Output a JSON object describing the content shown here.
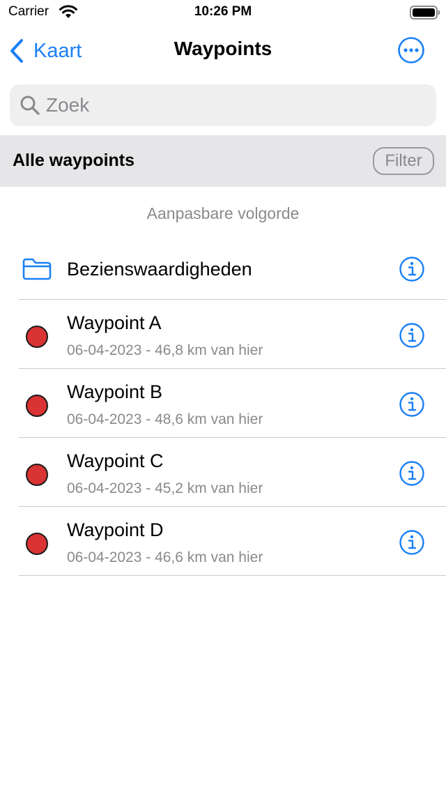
{
  "status_bar": {
    "carrier": "Carrier",
    "time": "10:26 PM"
  },
  "nav": {
    "back_label": "Kaart",
    "title": "Waypoints"
  },
  "search": {
    "placeholder": "Zoek"
  },
  "section": {
    "title": "Alle waypoints",
    "filter_label": "Filter"
  },
  "order_label": "Aanpasbare volgorde",
  "folder": {
    "label": "Bezienswaardigheden"
  },
  "waypoints": [
    {
      "name": "Waypoint A",
      "detail": "06-04-2023 - 46,8 km van hier"
    },
    {
      "name": "Waypoint B",
      "detail": "06-04-2023 - 48,6 km van hier"
    },
    {
      "name": "Waypoint C",
      "detail": "06-04-2023 - 45,2 km van hier"
    },
    {
      "name": "Waypoint D",
      "detail": "06-04-2023 - 46,6 km van hier"
    }
  ],
  "colors": {
    "accent": "#1a7ff5",
    "waypoint_marker": "#d93333",
    "secondary_text": "#8a8a8e",
    "section_background": "#e6e6e9"
  },
  "icons": {
    "back": "chevron-left-icon",
    "more": "ellipsis-circle-icon",
    "search": "magnifier-icon",
    "folder": "folder-icon",
    "info": "info-circle-icon"
  }
}
